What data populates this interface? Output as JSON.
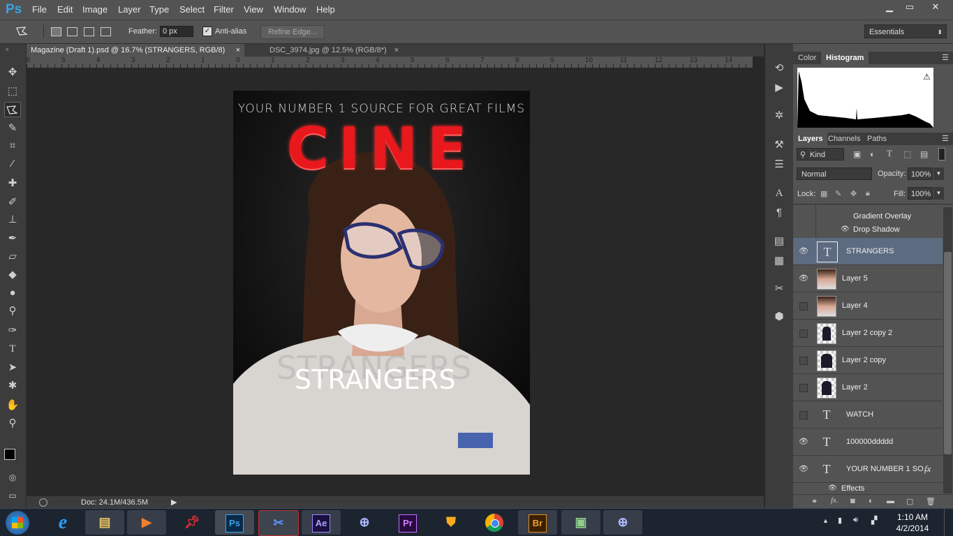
{
  "app": {
    "logo": "Ps"
  },
  "menu": [
    "File",
    "Edit",
    "Image",
    "Layer",
    "Type",
    "Select",
    "Filter",
    "View",
    "Window",
    "Help"
  ],
  "window_controls": {
    "minimize": "▁",
    "maximize": "▭",
    "close": "✕"
  },
  "options": {
    "feather_label": "Feather:",
    "feather_value": "0 px",
    "antialias_label": "Anti-alias",
    "refine_edge": "Refine Edge...",
    "workspace": "Essentials"
  },
  "documents": {
    "active_tab": "Magazine (Draft 1).psd @ 16.7% (STRANGERS, RGB/8)",
    "inactive_tab": "DSC_3974.jpg @ 12.5% (RGB/8*)",
    "close_glyph": "×"
  },
  "ruler": {
    "numbers": [
      "6",
      "5",
      "4",
      "3",
      "2",
      "1",
      "0",
      "1",
      "2",
      "3",
      "4",
      "5",
      "6",
      "7",
      "8",
      "9",
      "10",
      "11",
      "12",
      "13",
      "14"
    ]
  },
  "poster": {
    "tagline": "YOUR NUMBER 1 SOURCE FOR GREAT FILMS",
    "masthead": "CINE",
    "headline_shadow": "STRANGERS",
    "headline": "STRANGERS"
  },
  "status": {
    "doc_size": "Doc: 24.1M/436.5M"
  },
  "panels": {
    "top_tabs": [
      "Color",
      "Histogram"
    ],
    "active_top_tab": "Histogram",
    "layer_tabs": [
      "Layers",
      "Channels",
      "Paths"
    ],
    "filter_kind": "Kind",
    "blend_mode": "Normal",
    "opacity_label": "Opacity:",
    "opacity_value": "100%",
    "lock_label": "Lock:",
    "fill_label": "Fill:",
    "fill_value": "100%",
    "effects_header": "Effects",
    "effects_items": [
      "Gradient Overlay",
      "Drop Shadow"
    ],
    "layers": [
      {
        "name": "STRANGERS",
        "type": "text",
        "visible": true,
        "selected": true
      },
      {
        "name": "Layer 5",
        "type": "image",
        "visible": true,
        "selected": false
      },
      {
        "name": "Layer 4",
        "type": "image",
        "visible": false,
        "selected": false
      },
      {
        "name": "Layer 2 copy 2",
        "type": "image",
        "visible": false,
        "selected": false
      },
      {
        "name": "Layer 2 copy",
        "type": "image",
        "visible": false,
        "selected": false
      },
      {
        "name": "Layer 2",
        "type": "image",
        "visible": false,
        "selected": false
      },
      {
        "name": "WATCH",
        "type": "text",
        "visible": false,
        "selected": false
      },
      {
        "name": "100000ddddd",
        "type": "text",
        "visible": true,
        "selected": false
      },
      {
        "name": "YOUR NUMBER 1 SO...",
        "type": "text",
        "visible": true,
        "selected": false
      }
    ],
    "bottom_effects": "Effects",
    "fx_label": "fx"
  },
  "taskbar": {
    "apps": [
      "Ae",
      "Pr",
      "Br"
    ],
    "ps_app": "Ps",
    "time": "1:10 AM",
    "date": "4/2/2014"
  },
  "colors": {
    "accent_blue": "#3aa3e3",
    "masthead_red": "#e8181c",
    "selected_layer": "#5d6b80"
  }
}
